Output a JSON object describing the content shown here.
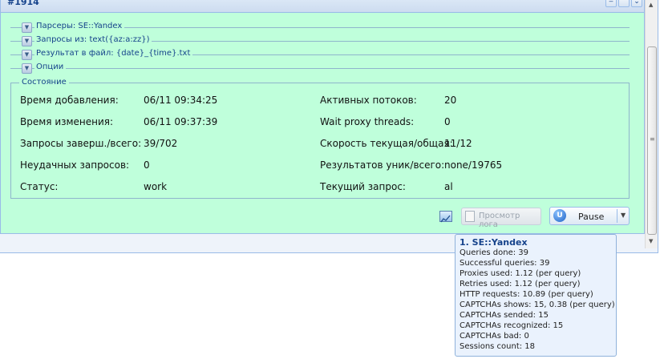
{
  "window": {
    "title": "#1914"
  },
  "sections": [
    {
      "label": "Парсеры: SE::Yandex"
    },
    {
      "label": "Запросы из: text({az:a:zz})"
    },
    {
      "label": "Результат в файл: {date}_{time}.txt"
    },
    {
      "label": "Опции"
    }
  ],
  "state": {
    "legend": "Состояние",
    "left": [
      {
        "label": "Время добавления:",
        "value": "06/11 09:34:25"
      },
      {
        "label": "Время изменения:",
        "value": "06/11 09:37:39"
      },
      {
        "label": "Запросы заверш./всего:",
        "value": "39/702"
      },
      {
        "label": "Неудачных запросов:",
        "value": "0"
      },
      {
        "label": "Статус:",
        "value": "work"
      }
    ],
    "right": [
      {
        "label": "Активных потоков:",
        "value": "20"
      },
      {
        "label": "Wait proxy threads:",
        "value": "0"
      },
      {
        "label": "Скорость текущая/общая:",
        "value": "11/12"
      },
      {
        "label": "Результатов уник/всего:",
        "value": "none/19765"
      },
      {
        "label": "Текущий запрос:",
        "value": "al"
      }
    ]
  },
  "footer": {
    "log_button": "Просмотр лога",
    "pause_button": "Pause"
  },
  "tooltip": {
    "title": "1. SE::Yandex",
    "lines": [
      "Queries done: 39",
      "Successful queries: 39",
      "Proxies used: 1.12 (per query)",
      "Retries used: 1.12 (per query)",
      "HTTP requests: 10.89 (per query)",
      "CAPTCHAs shows: 15, 0.38 (per query)",
      "CAPTCHAs sended: 15",
      "CAPTCHAs recognized: 15",
      "CAPTCHAs bad: 0",
      "Sessions count: 18"
    ]
  },
  "icons": {
    "collapse": "chevron-down-icon",
    "tools": [
      "minimize-icon",
      "collapse-icon",
      "restore-icon"
    ],
    "chart": "chart-icon",
    "log": "document-icon",
    "pause": "pause-logo-icon",
    "dropdown": "chevron-down-icon"
  }
}
